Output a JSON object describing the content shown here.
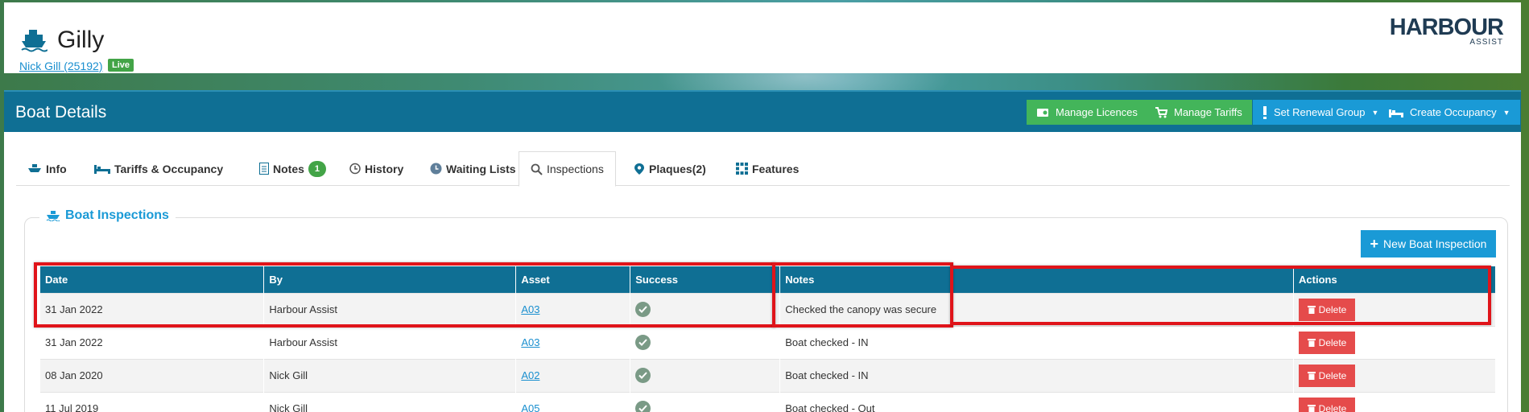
{
  "boat": {
    "name": "Gilly",
    "owner_link": "Nick Gill (25192)",
    "status_badge": "Live"
  },
  "logo": {
    "main": "HARBOUR",
    "sub": "ASSIST"
  },
  "panel": {
    "title": "Boat Details",
    "buttons": {
      "manage_licences": "Manage Licences",
      "manage_tariffs": "Manage Tariffs",
      "set_renewal_group": "Set Renewal Group",
      "create_occupancy": "Create Occupancy"
    }
  },
  "tabs": {
    "info": "Info",
    "tariffs": "Tariffs & Occupancy",
    "notes": "Notes",
    "notes_count": "1",
    "history": "History",
    "waiting_lists": "Waiting Lists",
    "inspections": "Inspections",
    "plaques": "Plaques(2)",
    "features": "Features"
  },
  "inspections": {
    "legend": "Boat Inspections",
    "new_button": "New Boat Inspection",
    "columns": [
      "Date",
      "By",
      "Asset",
      "Success",
      "Notes",
      "Actions"
    ],
    "delete_label": "Delete",
    "rows": [
      {
        "date": "31 Jan 2022",
        "by": "Harbour Assist",
        "asset": "A03",
        "notes": "Checked the canopy was secure"
      },
      {
        "date": "31 Jan 2022",
        "by": "Harbour Assist",
        "asset": "A03",
        "notes": "Boat checked - IN"
      },
      {
        "date": "08 Jan 2020",
        "by": "Nick Gill",
        "asset": "A02",
        "notes": "Boat checked - IN"
      },
      {
        "date": "11 Jul 2019",
        "by": "Nick Gill",
        "asset": "A05",
        "notes": "Boat checked - Out"
      }
    ]
  },
  "colors": {
    "header_blue": "#0f6f94",
    "button_green": "#43b55a",
    "button_blue": "#1a9ad6",
    "delete_red": "#e54b4b",
    "highlight_red": "#e0141a"
  }
}
